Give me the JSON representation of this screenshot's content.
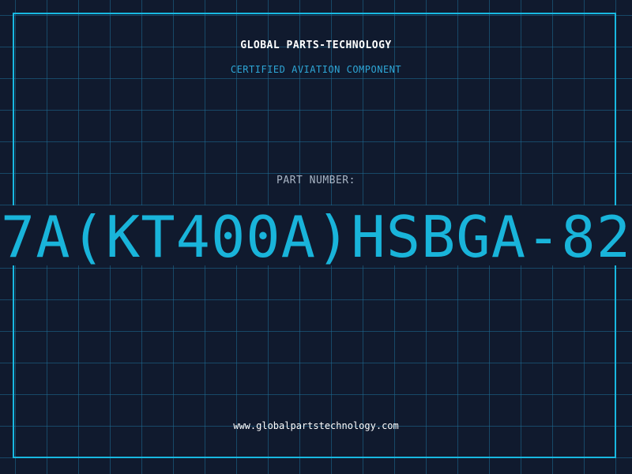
{
  "header": {
    "company": "GLOBAL PARTS-TECHNOLOGY",
    "subtitle": "CERTIFIED AVIATION COMPONENT"
  },
  "part": {
    "label": "PART NUMBER:",
    "number": "7A(KT400A)HSBGA-82"
  },
  "footer": {
    "website": "www.globalpartstechnology.com"
  },
  "colors": {
    "background": "#101a2e",
    "accent": "#19b4da",
    "grid": "#1e6e96"
  }
}
